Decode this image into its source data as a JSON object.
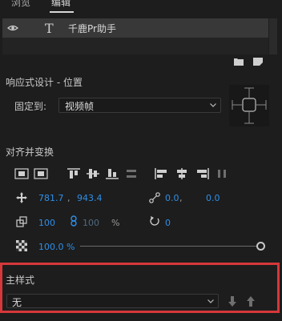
{
  "tabs": {
    "browse": "浏览",
    "edit": "编辑"
  },
  "layer": {
    "type_glyph": "T",
    "name": "千鹿Pr助手",
    "icon": "eye-icon"
  },
  "responsive": {
    "title": "响应式设计 - 位置",
    "pin_label": "固定到:",
    "pin_value": "视频帧"
  },
  "align": {
    "title": "对齐并变换"
  },
  "transform": {
    "pos_x": "781.7",
    "comma1": ",",
    "pos_y": "943.4",
    "anchor_x": "0.0",
    "comma2": ",",
    "anchor_y": "0.0",
    "scale": "100",
    "scale_locked": "100",
    "scale_unit": "%",
    "rotation": "0",
    "opacity": "100.0 %"
  },
  "master": {
    "title": "主样式",
    "value": "无"
  },
  "colors": {
    "accent_value": "#2e8fe8",
    "highlight_border": "#d6383a"
  }
}
